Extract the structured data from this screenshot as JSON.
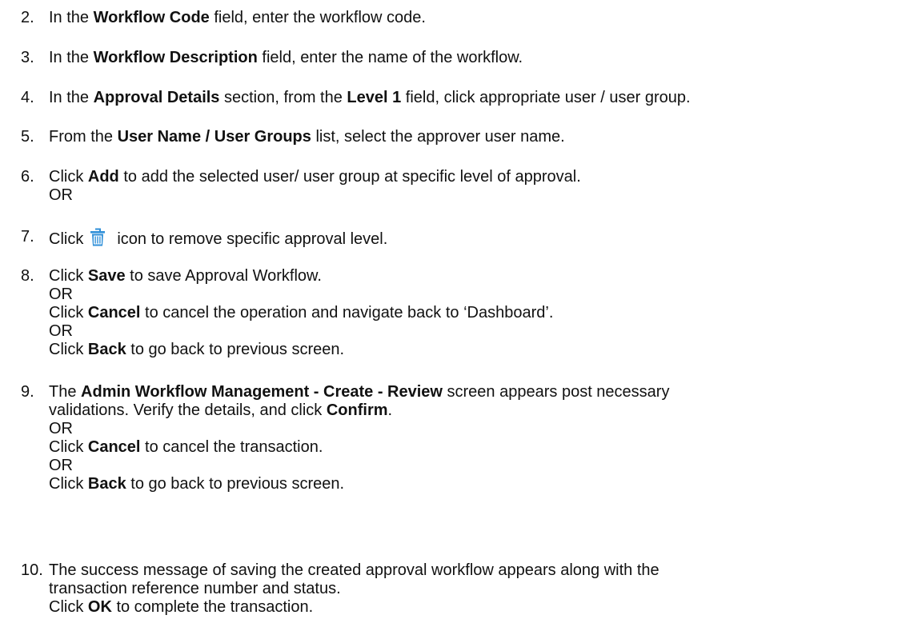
{
  "steps": [
    {
      "num": "2.",
      "parts": [
        "In the ",
        "Workflow Code",
        " field, enter the workflow code."
      ]
    },
    {
      "num": "3.",
      "parts": [
        "In the ",
        "Workflow Description",
        " field, enter the name of the workflow."
      ]
    },
    {
      "num": "4.",
      "parts": [
        "In the ",
        "Approval Details",
        " section, from the ",
        "Level 1",
        " field, click appropriate user / user group."
      ]
    },
    {
      "num": "5.",
      "parts": [
        "From the ",
        "User Name / User Groups",
        " list, select the approver user name."
      ]
    },
    {
      "num": "6.",
      "parts": [
        "Click ",
        "Add",
        " to add the selected user/ user group at specific level of approval."
      ],
      "or": "OR"
    },
    {
      "num": "7.",
      "click": "Click",
      "icon": "trash-icon",
      "rest": "icon to remove specific approval level."
    },
    {
      "num": "8.",
      "lines": [
        [
          "Click ",
          "Save",
          " to save Approval Workflow."
        ],
        [
          "OR"
        ],
        [
          "Click ",
          "Cancel",
          " to cancel the operation and navigate back to ‘Dashboard’."
        ],
        [
          "OR"
        ],
        [
          "Click ",
          "Back",
          " to go back to previous screen."
        ]
      ]
    },
    {
      "num": "9.",
      "lines": [
        [
          "The ",
          "Admin Workflow Management - Create - Review",
          " screen appears post necessary"
        ],
        [
          "validations. Verify the details, and click ",
          "Confirm",
          "."
        ],
        [
          "OR"
        ],
        [
          "Click ",
          "Cancel",
          " to cancel the transaction."
        ],
        [
          "OR"
        ],
        [
          "Click ",
          "Back",
          " to go back to previous screen."
        ]
      ]
    },
    {
      "num": "10.",
      "lines": [
        [
          "The success message of saving the created approval workflow appears along with the"
        ],
        [
          "transaction reference number and status."
        ],
        [
          "Click ",
          "OK",
          " to complete the transaction."
        ]
      ]
    }
  ],
  "colors": {
    "text": "#111111",
    "icon": "#2f8fd8"
  }
}
